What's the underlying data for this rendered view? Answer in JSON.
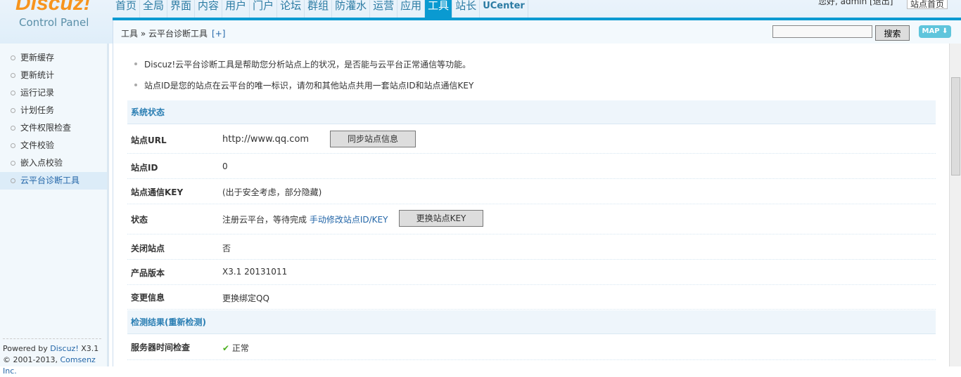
{
  "header": {
    "logo": "Discuz!",
    "subtitle": "Control Panel",
    "user": "您好, admin [退出]",
    "home": "站点首页",
    "nav": [
      "首页",
      "全局",
      "界面",
      "内容",
      "用户",
      "门户",
      "论坛",
      "群组",
      "防灌水",
      "运营",
      "应用",
      "工具",
      "站长",
      "UCenter"
    ],
    "active": "工具"
  },
  "breadcrumb": {
    "parent": "工具",
    "sep": "»",
    "current": "云平台诊断工具",
    "toggle": "[+]",
    "search_btn": "搜索",
    "map": "MAP ⬇"
  },
  "sidebar": {
    "items": [
      "更新缓存",
      "更新统计",
      "运行记录",
      "计划任务",
      "文件权限检查",
      "文件校验",
      "嵌入点校验",
      "云平台诊断工具"
    ],
    "powered": "Powered by",
    "brand": "Discuz!",
    "version": "X3.1",
    "copy": "© 2001-2013,",
    "company": "Comsenz Inc."
  },
  "tips": [
    "Discuz!云平台诊断工具是帮助您分析站点上的状况，是否能与云平台正常通信等功能。",
    "站点ID是您的站点在云平台的唯一标识，请勿和其他站点共用一套站点ID和站点通信KEY"
  ],
  "status": {
    "title": "系统状态",
    "url_label": "站点URL",
    "url": "http://www.qq.com",
    "sync_btn": "同步站点信息",
    "id_label": "站点ID",
    "id": "0",
    "key_label": "站点通信KEY",
    "key": "(出于安全考虑，部分隐藏)",
    "state_label": "状态",
    "state": "注册云平台，等待完成",
    "state_link": "手动修改站点ID/KEY",
    "key_btn": "更换站点KEY",
    "close_label": "关闭站点",
    "close": "否",
    "ver_label": "产品版本",
    "ver": "X3.1 20131011",
    "change_label": "变更信息",
    "change_link": "更换绑定QQ"
  },
  "check": {
    "title": "检测结果(重新检测)",
    "time_label": "服务器时间检查",
    "time": "正常"
  }
}
